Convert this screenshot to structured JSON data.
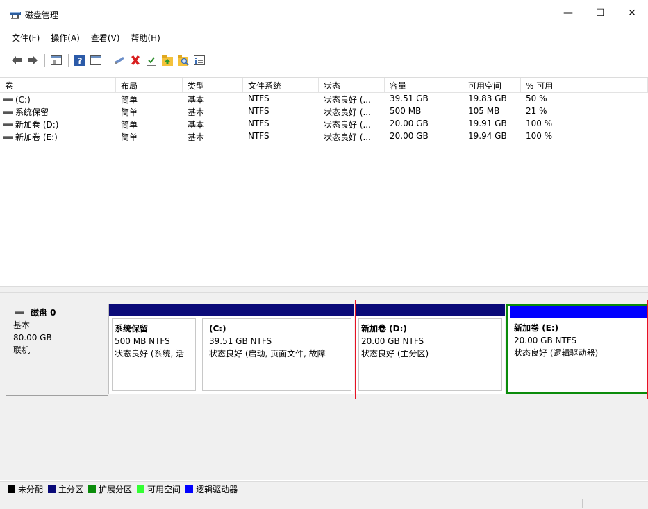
{
  "window": {
    "title": "磁盘管理",
    "minimize": "—",
    "maximize": "☐",
    "close": "✕"
  },
  "menu": [
    "文件(F)",
    "操作(A)",
    "查看(V)",
    "帮助(H)"
  ],
  "toolbar": {
    "icons": [
      "back-icon",
      "forward-icon",
      "console-tree-icon",
      "help-icon",
      "properties-icon",
      "connect-icon",
      "delete-icon",
      "check-icon",
      "folder-up-icon",
      "search-folder-icon",
      "list-icon"
    ]
  },
  "volumes": {
    "headers": [
      "卷",
      "布局",
      "类型",
      "文件系统",
      "状态",
      "容量",
      "可用空间",
      "% 可用",
      ""
    ],
    "rows": [
      [
        "(C:)",
        "简单",
        "基本",
        "NTFS",
        "状态良好 (...",
        "39.51 GB",
        "19.83 GB",
        "50 %"
      ],
      [
        "系统保留",
        "简单",
        "基本",
        "NTFS",
        "状态良好 (...",
        "500 MB",
        "105 MB",
        "21 %"
      ],
      [
        "新加卷 (D:)",
        "简单",
        "基本",
        "NTFS",
        "状态良好 (...",
        "20.00 GB",
        "19.91 GB",
        "100 %"
      ],
      [
        "新加卷 (E:)",
        "简单",
        "基本",
        "NTFS",
        "状态良好 (...",
        "20.00 GB",
        "19.94 GB",
        "100 %"
      ]
    ]
  },
  "disk0": {
    "name": "磁盘 0",
    "type": "基本",
    "size": "80.00 GB",
    "state": "联机",
    "partitions": [
      {
        "name": "系统保留",
        "size": "500 MB NTFS",
        "status": "状态良好 (系统, 活"
      },
      {
        "name": "(C:)",
        "size": "39.51 GB NTFS",
        "status": "状态良好 (启动, 页面文件, 故障"
      },
      {
        "name": "新加卷  (D:)",
        "size": "20.00 GB NTFS",
        "status": "状态良好 (主分区)"
      },
      {
        "name": "新加卷  (E:)",
        "size": "20.00 GB NTFS",
        "status": "状态良好 (逻辑驱动器)"
      }
    ]
  },
  "legend": [
    {
      "label": "未分配",
      "color": "#000000"
    },
    {
      "label": "主分区",
      "color": "#0a0a78"
    },
    {
      "label": "扩展分区",
      "color": "#0b8c0b"
    },
    {
      "label": "可用空间",
      "color": "#33ff33"
    },
    {
      "label": "逻辑驱动器",
      "color": "#0000ff"
    }
  ],
  "colors": {
    "primary_bar": "#0a0a78",
    "logical_bar": "#0000ff",
    "extended_border": "#0b8c0b",
    "selection": "#e81123"
  }
}
